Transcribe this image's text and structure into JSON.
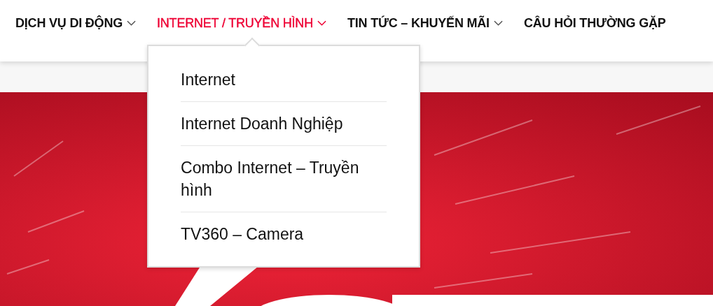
{
  "nav": {
    "items": [
      {
        "label": "DỊCH VỤ DI ĐỘNG",
        "selected": false,
        "has_submenu": true
      },
      {
        "label": "INTERNET / TRUYỀN HÌNH",
        "selected": true,
        "has_submenu": true,
        "submenu": [
          "Internet",
          "Internet Doanh Nghiệp",
          "Combo Internet – Truyền hình",
          "TV360 – Camera"
        ]
      },
      {
        "label": "TIN TỨC – KHUYẾN MÃI",
        "selected": false,
        "has_submenu": true
      },
      {
        "label": "CÂU HỎI THƯỜNG GẶP",
        "selected": false,
        "has_submenu": false
      }
    ]
  }
}
